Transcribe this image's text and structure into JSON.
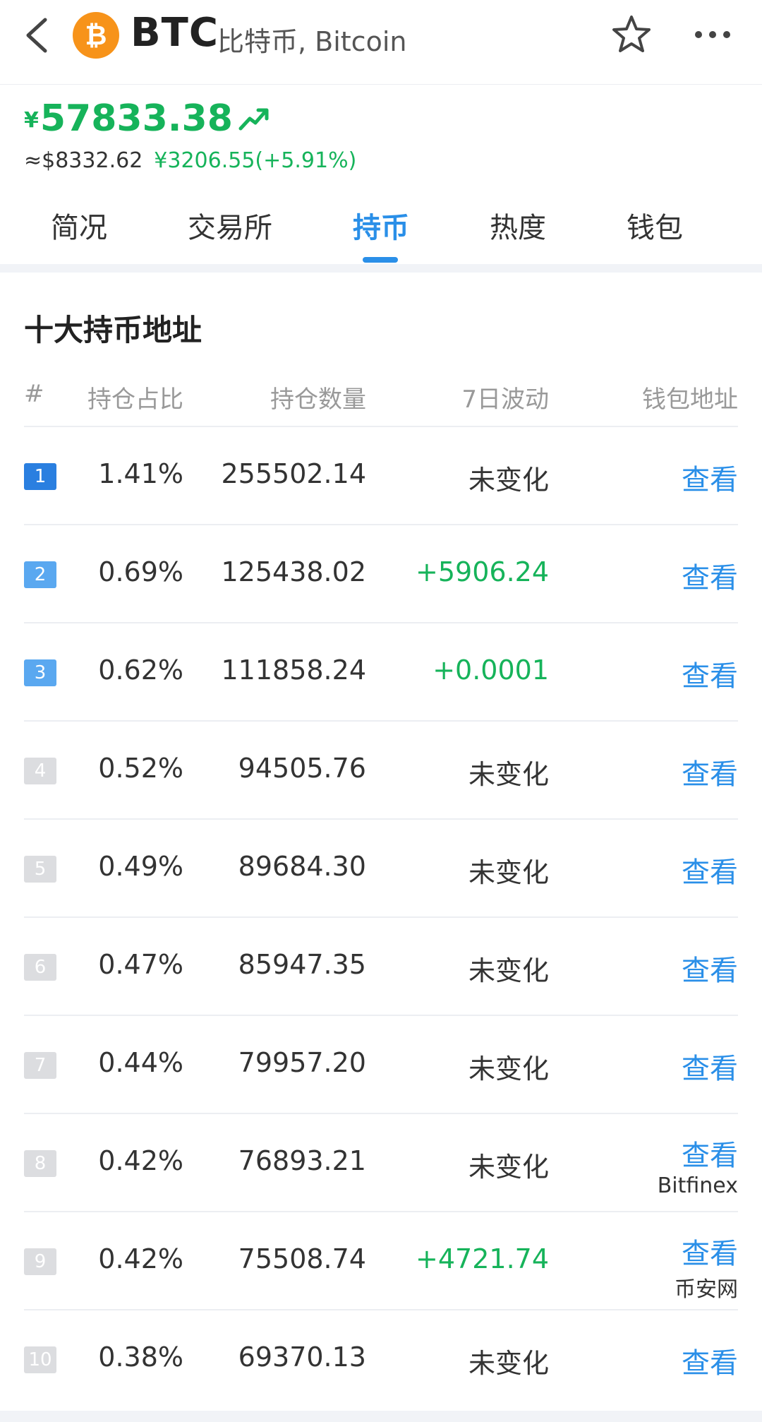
{
  "header": {
    "ticker": "BTC",
    "coin_name": "比特币, Bitcoin"
  },
  "price": {
    "currency": "¥",
    "value": "57833.38",
    "usd": "≈$8332.62",
    "change": "¥3206.55(+5.91%)"
  },
  "tabs": [
    {
      "label": "简况",
      "active": false
    },
    {
      "label": "交易所",
      "active": false
    },
    {
      "label": "持币",
      "active": true
    },
    {
      "label": "热度",
      "active": false
    },
    {
      "label": "钱包",
      "active": false
    }
  ],
  "section": {
    "title": "十大持币地址"
  },
  "table": {
    "headers": {
      "rank": "#",
      "pct": "持仓占比",
      "qty": "持仓数量",
      "vol": "7日波动",
      "wallet": "钱包地址"
    },
    "rows": [
      {
        "rank": "1",
        "pct": "1.41%",
        "qty": "255502.14",
        "vol": "未变化",
        "view": "查看",
        "label": ""
      },
      {
        "rank": "2",
        "pct": "0.69%",
        "qty": "125438.02",
        "vol": "+5906.24",
        "view": "查看",
        "label": ""
      },
      {
        "rank": "3",
        "pct": "0.62%",
        "qty": "111858.24",
        "vol": "+0.0001",
        "view": "查看",
        "label": ""
      },
      {
        "rank": "4",
        "pct": "0.52%",
        "qty": "94505.76",
        "vol": "未变化",
        "view": "查看",
        "label": ""
      },
      {
        "rank": "5",
        "pct": "0.49%",
        "qty": "89684.30",
        "vol": "未变化",
        "view": "查看",
        "label": ""
      },
      {
        "rank": "6",
        "pct": "0.47%",
        "qty": "85947.35",
        "vol": "未变化",
        "view": "查看",
        "label": ""
      },
      {
        "rank": "7",
        "pct": "0.44%",
        "qty": "79957.20",
        "vol": "未变化",
        "view": "查看",
        "label": ""
      },
      {
        "rank": "8",
        "pct": "0.42%",
        "qty": "76893.21",
        "vol": "未变化",
        "view": "查看",
        "label": "Bitfinex"
      },
      {
        "rank": "9",
        "pct": "0.42%",
        "qty": "75508.74",
        "vol": "+4721.74",
        "view": "查看",
        "label": "币安网"
      },
      {
        "rank": "10",
        "pct": "0.38%",
        "qty": "69370.13",
        "vol": "未变化",
        "view": "查看",
        "label": ""
      }
    ]
  },
  "colors": {
    "accent": "#2a8fe8",
    "positive": "#16b35a",
    "btc_orange": "#f7931a"
  },
  "icons": {
    "back": "chevron-left-icon",
    "coin": "bitcoin-icon",
    "favorite": "star-icon",
    "more": "more-dots-icon",
    "trend": "trend-up-icon"
  }
}
